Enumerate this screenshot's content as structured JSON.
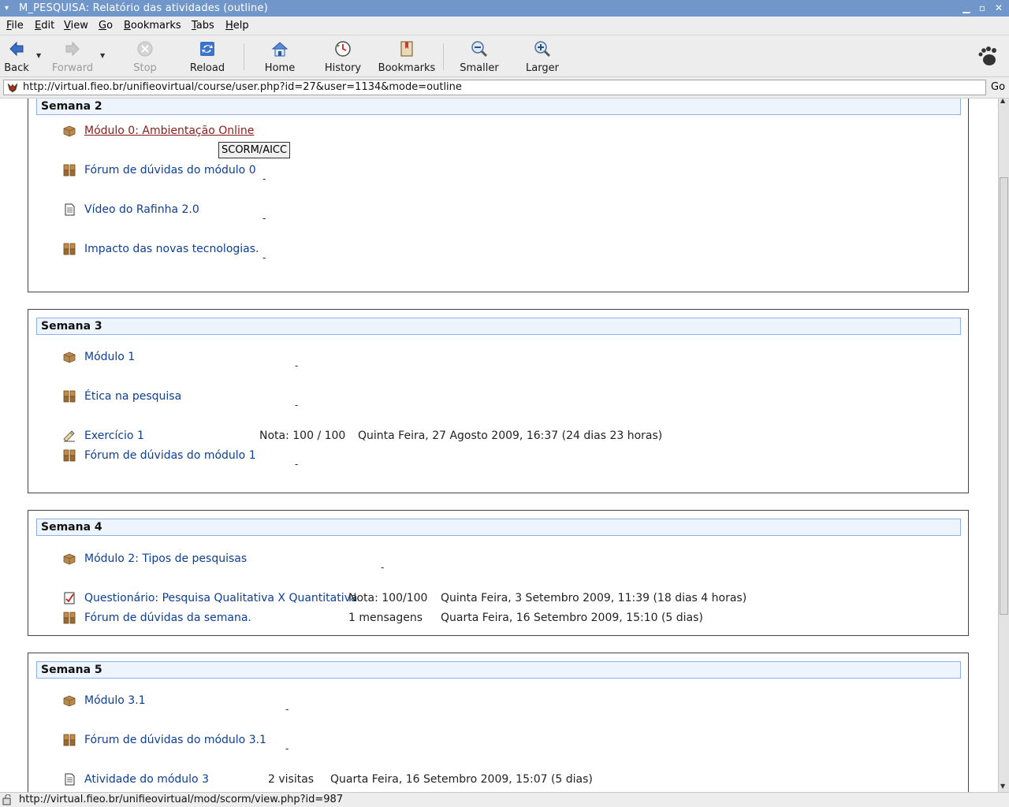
{
  "window": {
    "title": "M_PESQUISA: Relatório das atividades (outline)",
    "menu_glyph": "▾",
    "minimize": "▁",
    "maximize": "▫",
    "close": "✕"
  },
  "menubar": {
    "items": [
      "File",
      "Edit",
      "View",
      "Go",
      "Bookmarks",
      "Tabs",
      "Help"
    ]
  },
  "toolbar": {
    "back": "Back",
    "forward": "Forward",
    "stop": "Stop",
    "reload": "Reload",
    "home": "Home",
    "history": "History",
    "bookmarks": "Bookmarks",
    "smaller": "Smaller",
    "larger": "Larger"
  },
  "address": {
    "url": "http://virtual.fieo.br/unifieovirtual/course/user.php?id=27&user=1134&mode=outline",
    "go": "Go"
  },
  "tooltip": "SCORM/AICC",
  "sections": {
    "s2": {
      "title": "Semana 2",
      "items": [
        {
          "label": "Módulo 0: Ambientação Online",
          "icon": "scorm-package-icon"
        },
        {
          "label": "Fórum de dúvidas do módulo 0",
          "icon": "forum-icon",
          "dash": "-"
        },
        {
          "label": "Vídeo do Rafinha 2.0",
          "icon": "resource-page-icon",
          "dash": "-"
        },
        {
          "label": "Impacto das novas tecnologias.",
          "icon": "forum-icon",
          "dash": "-"
        }
      ]
    },
    "s3": {
      "title": "Semana 3",
      "items": [
        {
          "label": "Módulo 1",
          "icon": "scorm-package-icon",
          "dash": "-"
        },
        {
          "label": "Ética na pesquisa",
          "icon": "forum-icon",
          "dash": "-"
        },
        {
          "label": "Exercício 1",
          "icon": "assignment-icon",
          "grade": "Nota: 100 / 100",
          "date": "Quinta Feira, 27 Agosto 2009, 16:37 (24 dias 23 horas)"
        },
        {
          "label": "Fórum de dúvidas do módulo 1",
          "icon": "forum-icon",
          "dash": "-"
        }
      ]
    },
    "s4": {
      "title": "Semana 4",
      "items": [
        {
          "label": "Módulo 2: Tipos de pesquisas",
          "icon": "scorm-package-icon",
          "dash": "-"
        },
        {
          "label": "Questionário: Pesquisa Qualitativa X Quantitativa",
          "icon": "quiz-icon",
          "grade": "Nota: 100/100",
          "date": "Quinta Feira, 3 Setembro 2009, 11:39 (18 dias 4 horas)"
        },
        {
          "label": "Fórum de dúvidas da semana.",
          "icon": "forum-icon",
          "grade": "1 mensagens",
          "date": "Quarta Feira, 16 Setembro 2009, 15:10 (5 dias)"
        }
      ]
    },
    "s5": {
      "title": "Semana 5",
      "items": [
        {
          "label": "Módulo 3.1",
          "icon": "scorm-package-icon",
          "dash": "-"
        },
        {
          "label": "Fórum de dúvidas do módulo 3.1",
          "icon": "forum-icon",
          "dash": "-"
        },
        {
          "label": "Atividade do módulo 3",
          "icon": "resource-page-icon",
          "grade": "2 visitas",
          "date": "Quarta Feira, 16 Setembro 2009, 15:07 (5 dias)"
        }
      ]
    }
  },
  "status": {
    "text": "http://virtual.fieo.br/unifieovirtual/mod/scorm/view.php?id=987"
  }
}
